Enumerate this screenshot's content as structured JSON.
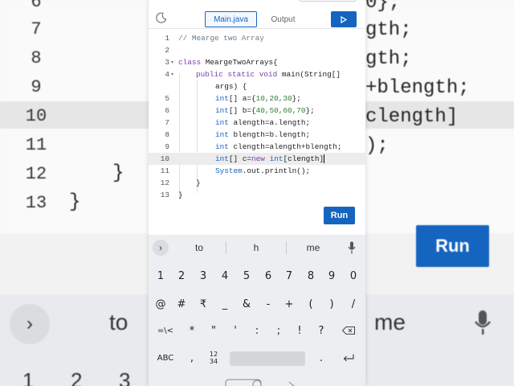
{
  "background": {
    "line_numbers": [
      "6",
      "7",
      "8",
      "9",
      "10",
      "11",
      "12",
      "13"
    ],
    "code_fragments": [
      "0};",
      "gth;",
      "gth;",
      "+blength;",
      "clength]",
      ");",
      "}",
      "}"
    ],
    "run_label": "Run",
    "suggestions": [
      "to",
      "me"
    ],
    "bottom_digits": [
      "1",
      "2",
      "3"
    ]
  },
  "header": {
    "file_tab": "Main.java",
    "output_tab": "Output"
  },
  "editor": {
    "lines": [
      {
        "n": "1"
      },
      {
        "n": "2"
      },
      {
        "n": "3"
      },
      {
        "n": "4"
      },
      {
        "n": "",
        "blank": true
      },
      {
        "n": "5"
      },
      {
        "n": "6"
      },
      {
        "n": "7"
      },
      {
        "n": "8"
      },
      {
        "n": "9"
      },
      {
        "n": "10"
      },
      {
        "n": "11"
      },
      {
        "n": "12"
      },
      {
        "n": "13"
      }
    ],
    "code": {
      "l1": "// Mearge two Array",
      "l3a": "class",
      "l3b": " MeargeTwoArrays{",
      "l4a": "public static void",
      "l4b": " main(String[]",
      "l4c": "args) {",
      "l5a": "int",
      "l5b": "[] a={",
      "l5c": "10,20,30",
      "l5d": "};",
      "l6a": "int",
      "l6b": "[] b={",
      "l6c": "40,50,60,70",
      "l6d": "};",
      "l7a": "int",
      "l7b": " alength=a.length;",
      "l8a": "int",
      "l8b": " blength=b.length;",
      "l9a": "int",
      "l9b": " clength=alength+blength;",
      "l10a": "int",
      "l10b": "[] c=",
      "l10c": "new",
      "l10d": " ",
      "l10e": "int",
      "l10f": "[clength]",
      "l11a": "System",
      "l11b": ".out.println();",
      "l12": "}",
      "l13": "}"
    }
  },
  "run_button": "Run",
  "keyboard": {
    "suggestions": [
      "to",
      "h",
      "me"
    ],
    "row1": [
      "1",
      "2",
      "3",
      "4",
      "5",
      "6",
      "7",
      "8",
      "9",
      "0"
    ],
    "row2": [
      "@",
      "#",
      "₹",
      "_",
      "&",
      "-",
      "+",
      "(",
      ")",
      "/"
    ],
    "row3": [
      "=\\<",
      "*",
      "\"",
      "'",
      ":",
      ";",
      "!",
      "?"
    ],
    "row4": {
      "abc": "ABC",
      "comma": ",",
      "numpad": "12\n34",
      "period": "."
    }
  },
  "colors": {
    "accent": "#1565c0",
    "keyword": "#7b3fa8",
    "type": "#1565c0",
    "number": "#2e7d32",
    "comment": "#6b7c8a"
  }
}
